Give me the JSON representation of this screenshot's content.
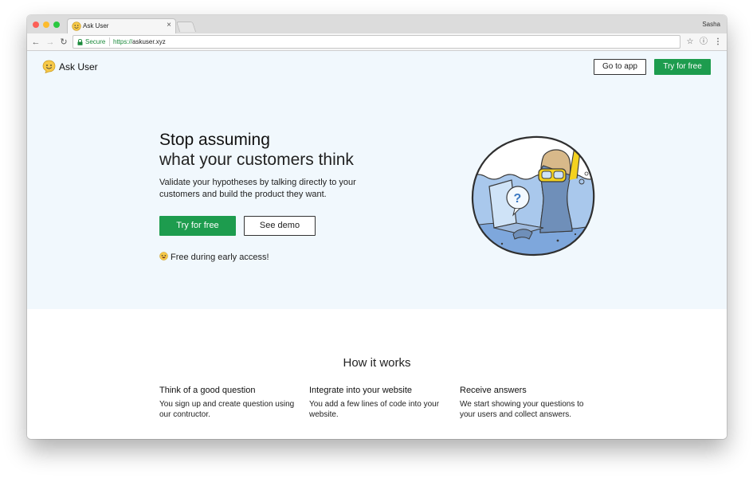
{
  "browser": {
    "tab_title": "Ask User",
    "tab_close": "×",
    "profile_name": "Sasha",
    "secure_label": "Secure",
    "url_scheme": "https://",
    "url_host": "askuser.xyz"
  },
  "header": {
    "brand_name": "Ask User",
    "go_to_app": "Go to app",
    "try_for_free": "Try for free"
  },
  "hero": {
    "headline_line1": "Stop assuming",
    "headline_line2": "what your customers think",
    "subtext": "Validate your hypotheses by talking directly to your customers and build the product they want.",
    "primary_cta": "Try for free",
    "secondary_cta": "See demo",
    "early_access": "Free during early access!"
  },
  "how_it_works": {
    "title": "How it works",
    "steps": [
      {
        "title": "Think of a good question",
        "text": "You sign up and create question using our contructor."
      },
      {
        "title": "Integrate into your website",
        "text": "You add a few lines of code into your website."
      },
      {
        "title": "Receive answers",
        "text": "We start showing your questions to your users and collect answers."
      }
    ]
  },
  "colors": {
    "accent_green": "#1d9c4e",
    "hero_background": "#f1f8fd",
    "secure_green": "#1a8a3b"
  },
  "icons": [
    "smiley-logo-icon",
    "lock-icon",
    "back-icon",
    "forward-icon",
    "reload-icon",
    "star-icon",
    "info-icon",
    "menu-icon",
    "laughing-emoji-icon",
    "diver-illustration"
  ]
}
